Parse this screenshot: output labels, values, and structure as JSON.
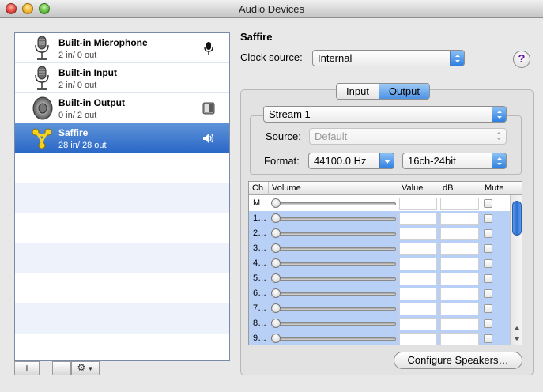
{
  "window": {
    "title": "Audio Devices"
  },
  "devices": [
    {
      "name": "Built-in Microphone",
      "io": "2 in/ 0 out",
      "icon": "microphone-icon",
      "badge": "microphone-badge-icon",
      "selected": false
    },
    {
      "name": "Built-in Input",
      "io": "2 in/ 0 out",
      "icon": "microphone-icon",
      "badge": "",
      "selected": false
    },
    {
      "name": "Built-in Output",
      "io": "0 in/ 2 out",
      "icon": "speaker-icon",
      "badge": "finder-badge-icon",
      "selected": false
    },
    {
      "name": "Saffire",
      "io": "28 in/ 28 out",
      "icon": "firewire-icon",
      "badge": "speaker-badge-icon",
      "selected": true
    }
  ],
  "list_toolbar": {
    "add": "+",
    "remove": "−",
    "action": "⚙"
  },
  "detail": {
    "device_title": "Saffire",
    "clock_source_label": "Clock source:",
    "clock_source_value": "Internal",
    "help": "?",
    "tabs": [
      {
        "label": "Input",
        "active": false
      },
      {
        "label": "Output",
        "active": true
      }
    ],
    "stream_value": "Stream 1",
    "source_label": "Source:",
    "source_value": "Default",
    "format_label": "Format:",
    "format_rate": "44100.0 Hz",
    "format_bits": "16ch-24bit"
  },
  "channel_table": {
    "headers": {
      "ch": "Ch",
      "volume": "Volume",
      "value": "Value",
      "db": "dB",
      "mute": "Mute"
    },
    "rows": [
      {
        "ch": "M",
        "selected": false
      },
      {
        "ch": "1…",
        "selected": true
      },
      {
        "ch": "2…",
        "selected": true
      },
      {
        "ch": "3…",
        "selected": true
      },
      {
        "ch": "4…",
        "selected": true
      },
      {
        "ch": "5…",
        "selected": true
      },
      {
        "ch": "6…",
        "selected": true
      },
      {
        "ch": "7…",
        "selected": true
      },
      {
        "ch": "8…",
        "selected": true
      },
      {
        "ch": "9…",
        "selected": true
      }
    ]
  },
  "configure_speakers": "Configure Speakers…",
  "colors": {
    "selection": "#2a68c8",
    "row_highlight": "#b8d0f5",
    "help_glyph": "#6a1fa6"
  }
}
